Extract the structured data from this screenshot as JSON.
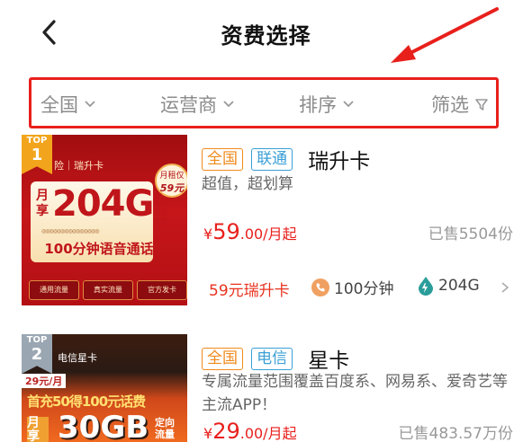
{
  "header": {
    "title": "资费选择"
  },
  "filters": [
    {
      "label": "全国",
      "icon": "chevron-down-icon"
    },
    {
      "label": "运营商",
      "icon": "chevron-down-icon"
    },
    {
      "label": "排序",
      "icon": "chevron-down-icon"
    },
    {
      "label": "筛选",
      "icon": "filter-icon"
    }
  ],
  "colors": {
    "accent": "#e8201c",
    "tag_orange": "#f08a1c",
    "tag_blue": "#3a9fd6"
  },
  "cards": [
    {
      "rank_label": "TOP",
      "rank": "1",
      "tags": [
        "全国",
        "联通"
      ],
      "name": "瑞升卡",
      "desc": "超值，超划算",
      "price_symbol": "¥",
      "price_int": "59",
      "price_suffix": ".00/月起",
      "sold": "已售5504份",
      "thumb": {
        "brand": "⁠险｜瑞升卡",
        "badge_top": "月租仅",
        "badge_price": "59元",
        "month_label": "月享",
        "data": "204G",
        "data_side": "全国通用流量",
        "promo_note": "◎◎◎◎◎◎◎◎◎◎◎◎◎◎◎",
        "voice": "100分钟语音通话",
        "icon1": "通用流量",
        "icon2": "真实流量",
        "icon3": "官方发卡"
      },
      "features": [
        {
          "icon": "",
          "text": "59元瑞升卡"
        },
        {
          "icon": "phone-icon",
          "text": "100分钟"
        },
        {
          "icon": "data-drop-icon",
          "text": "204G"
        }
      ]
    },
    {
      "rank_label": "TOP",
      "rank": "2",
      "tags": [
        "全国",
        "电信"
      ],
      "name": "星卡",
      "desc": "专属流量范围覆盖百度系、网易系、爱奇艺等主流APP！",
      "price_symbol": "¥",
      "price_int": "29",
      "price_suffix": ".00/月起",
      "sold": "已售483.57万份",
      "thumb": {
        "brand": "电信星卡",
        "badge_top": "29元/月",
        "promo": "首充50得100元话费",
        "month_label": "月享",
        "data": "30GB",
        "data_side": "定向流量"
      }
    }
  ]
}
